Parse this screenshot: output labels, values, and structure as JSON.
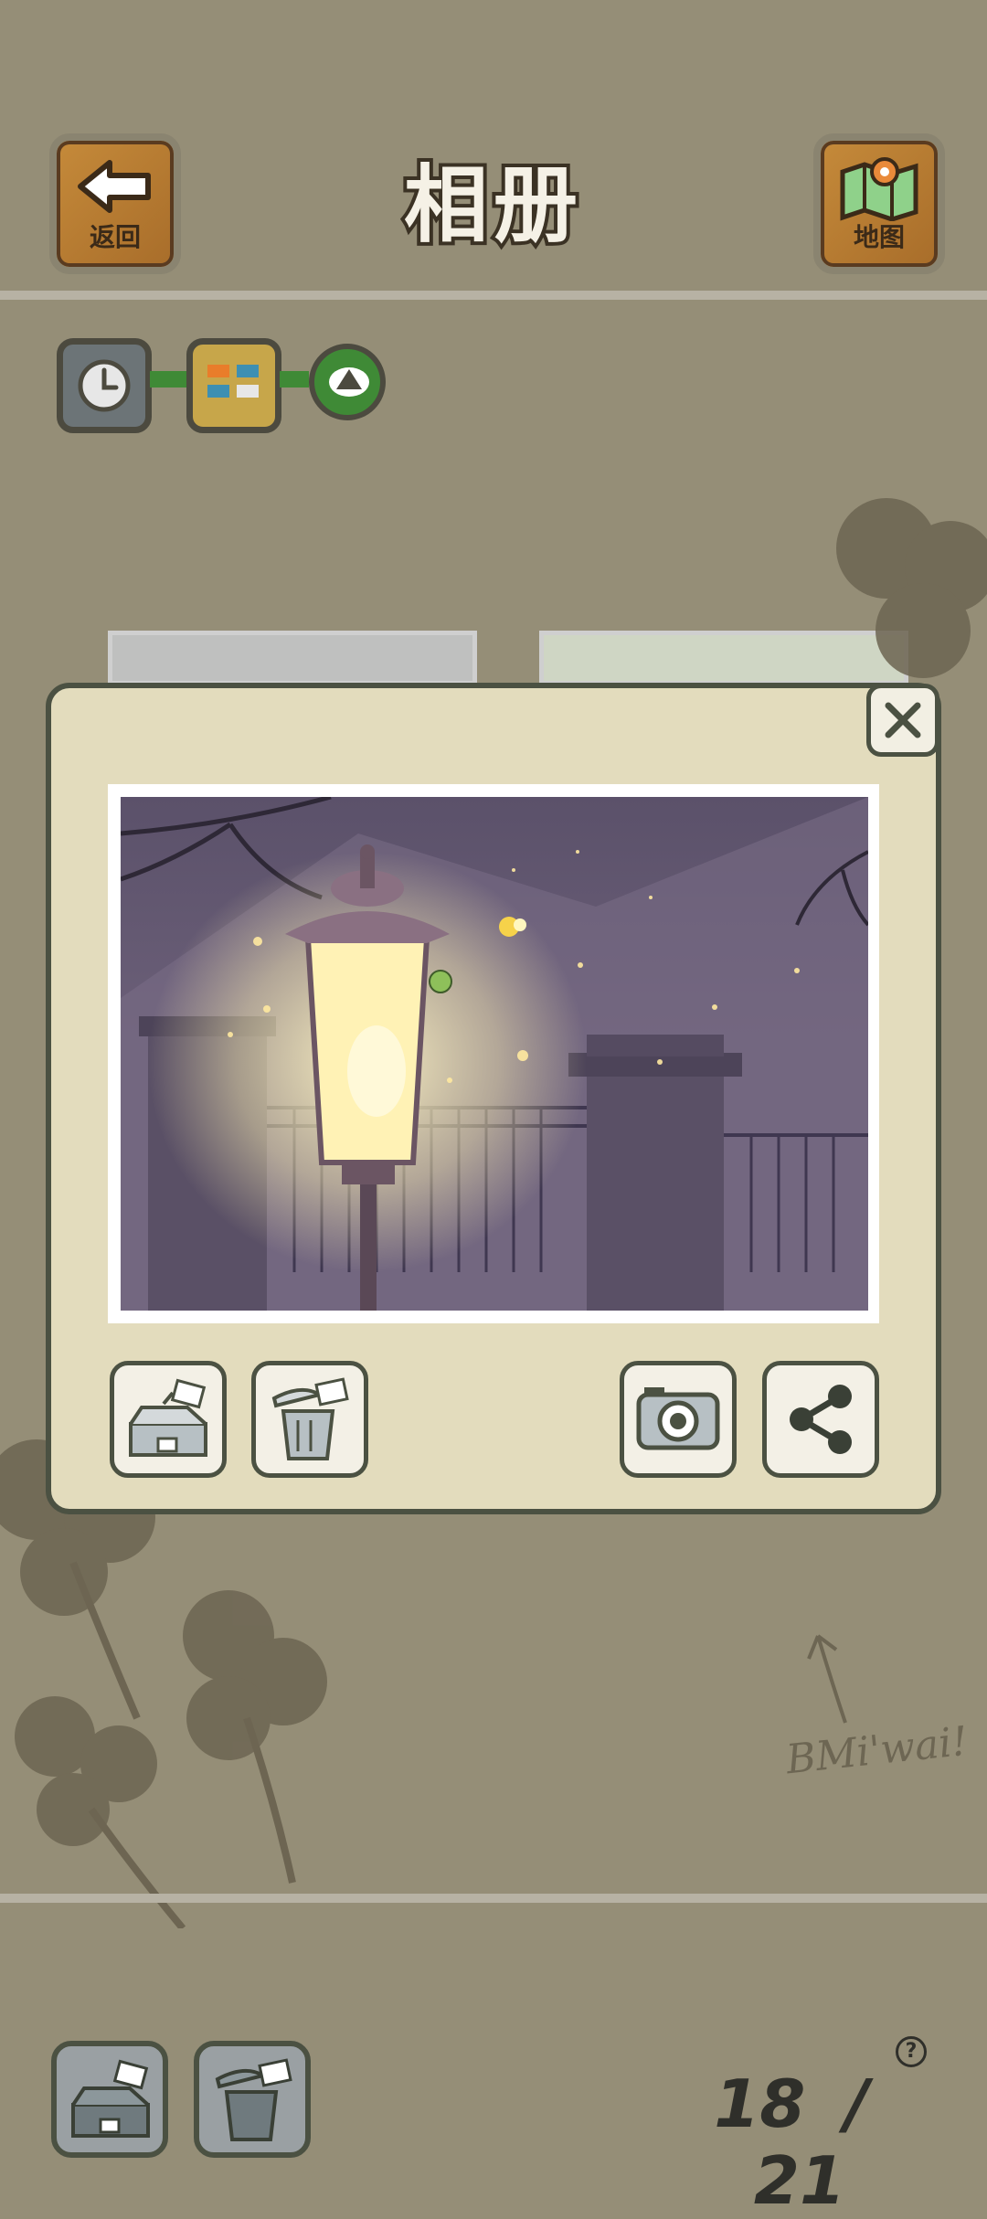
{
  "header": {
    "title": "相册",
    "back_label": "返回",
    "map_label": "地图"
  },
  "view_mode": {
    "options": [
      "clock-icon",
      "grid-icon",
      "collapse-icon"
    ],
    "colors": {
      "clock": "#6c7477",
      "grid": "#c7a64a",
      "collapse": "#3f8a36"
    }
  },
  "modal": {
    "photo_subject": "street lamp at night with fireflies",
    "actions": [
      "store-in-box-icon",
      "delete-trash-icon",
      "camera-icon",
      "share-icon"
    ]
  },
  "footer": {
    "current": "18",
    "separator": "/",
    "total": "21",
    "help": "?"
  },
  "signature": "BMi'wai!"
}
